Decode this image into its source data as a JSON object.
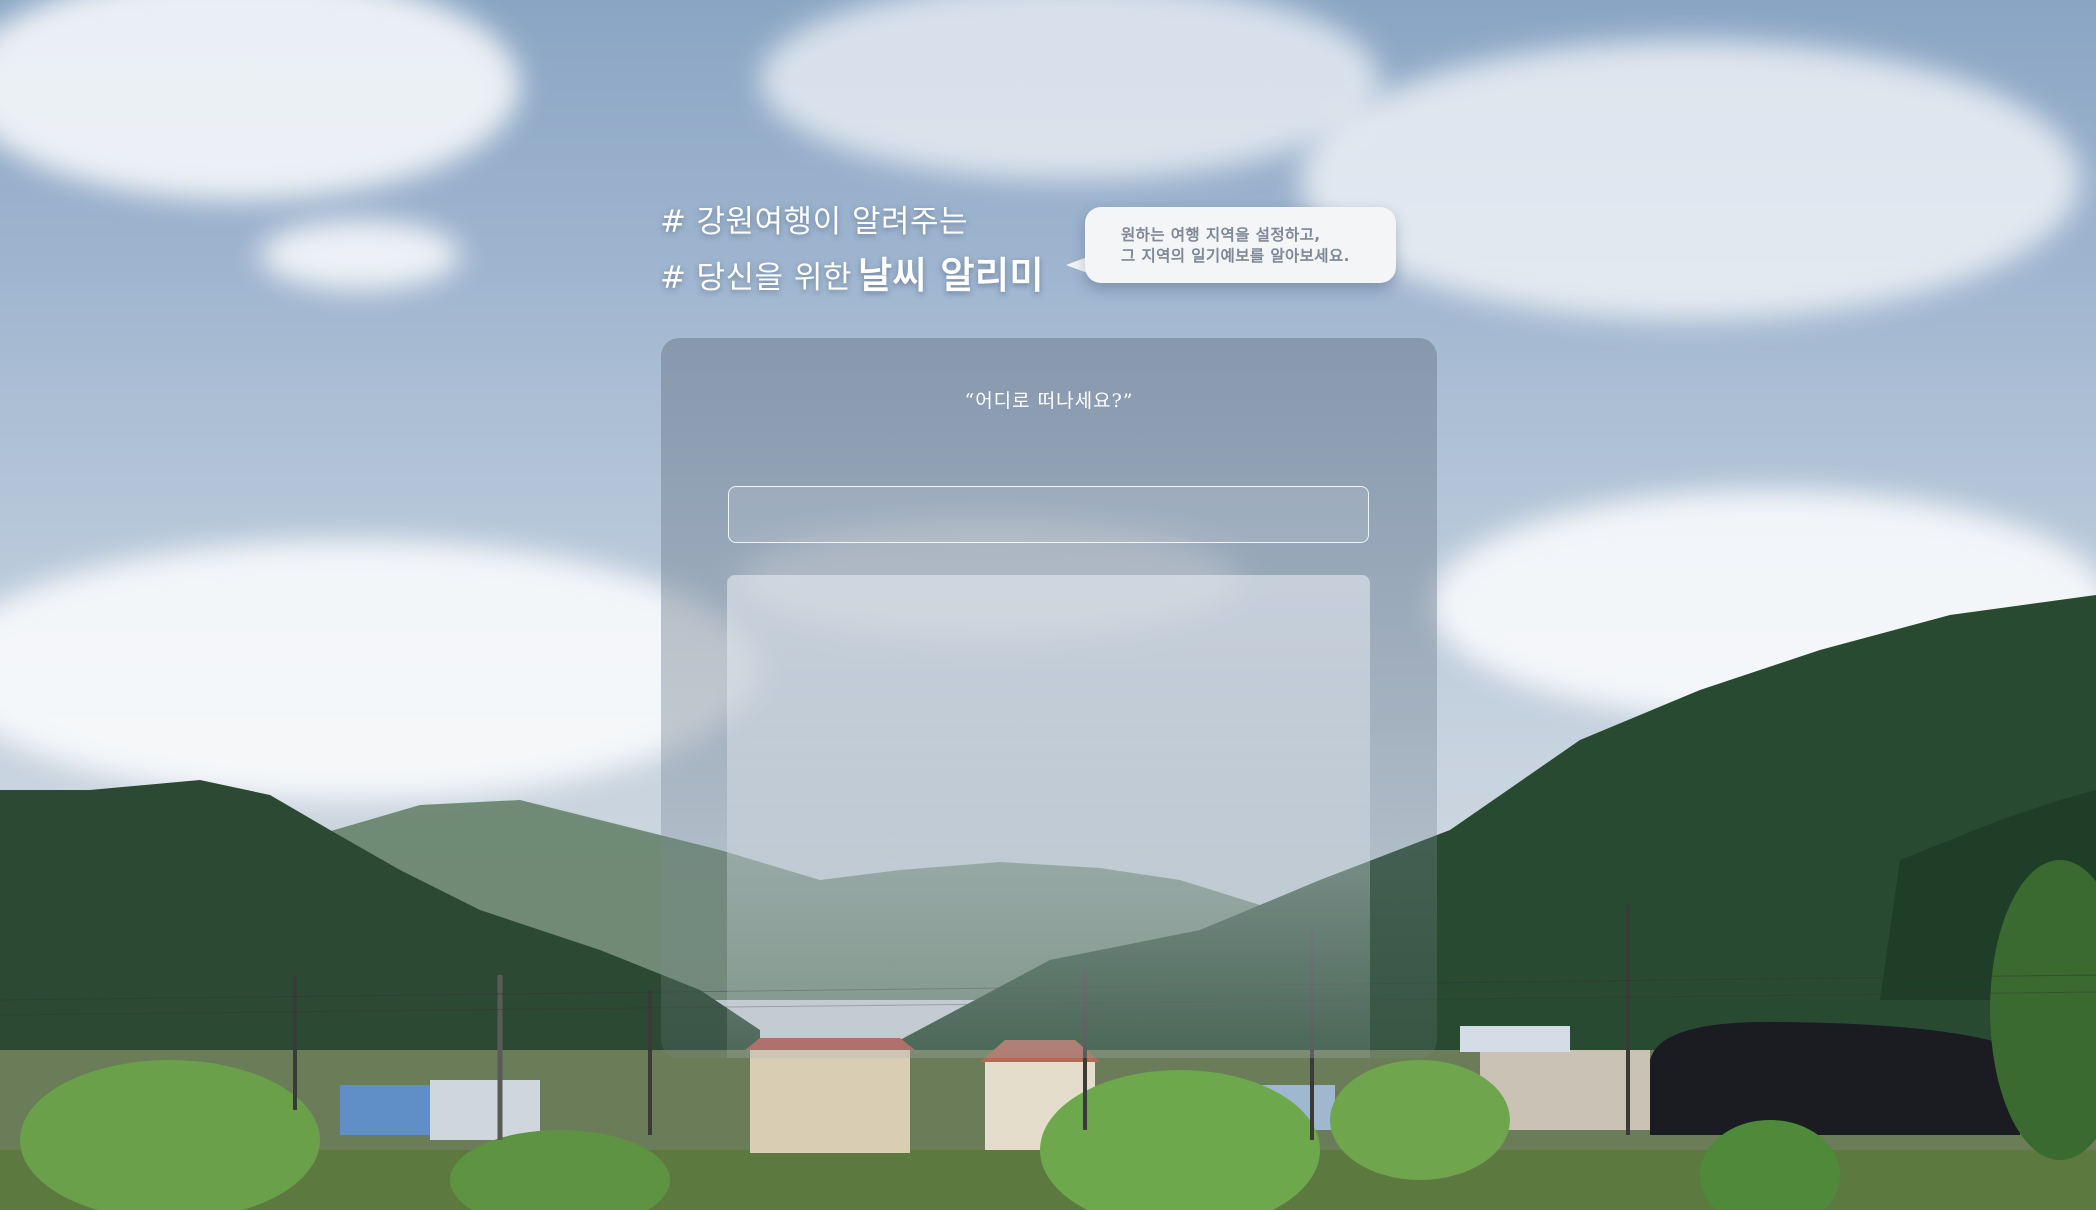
{
  "header": {
    "line1_prefix": "#",
    "line1_text": "강원여행이 알려주는",
    "line2_prefix": "#",
    "line2_text": "당신을 위한",
    "line2_strong": "날씨 알리미"
  },
  "bubble": {
    "line1": "원하는 여행 지역을 설정하고,",
    "line2": "그 지역의 일기예보를 알아보세요."
  },
  "panel": {
    "question": "“어디로 떠나세요?”",
    "search_value": "",
    "search_placeholder": ""
  },
  "background": {
    "description_icon": "landscape-photo"
  }
}
